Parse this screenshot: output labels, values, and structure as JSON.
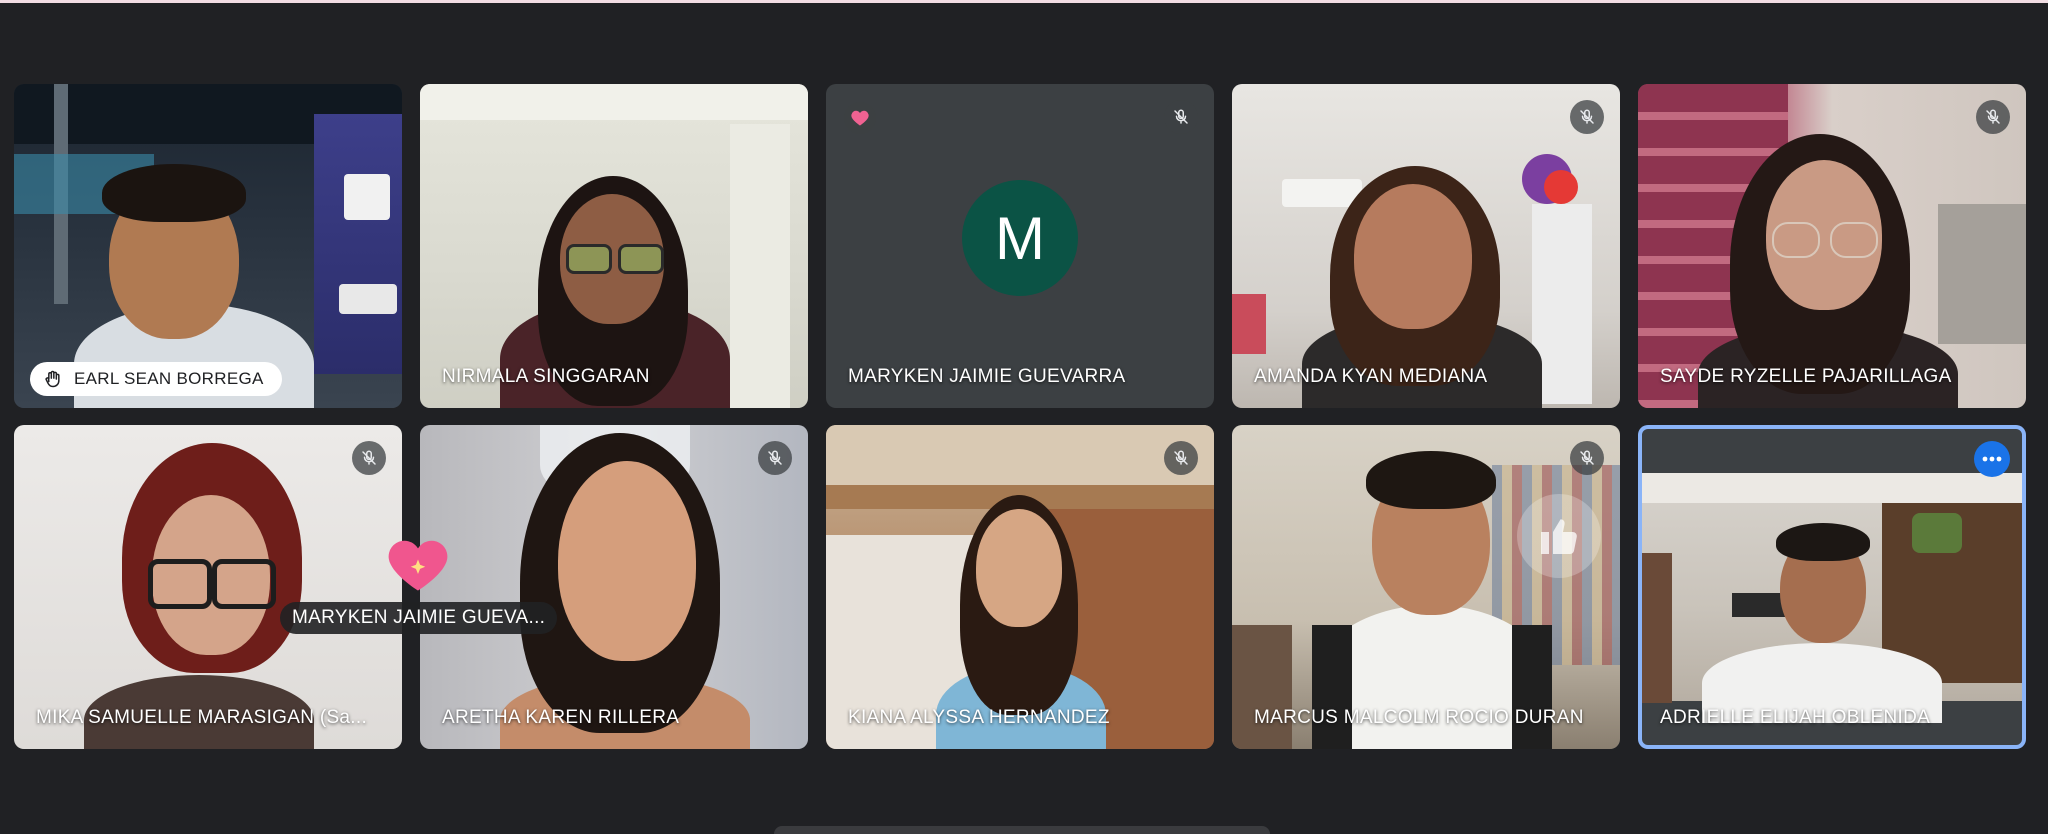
{
  "participants": [
    {
      "name": "EARL SEAN BORREGA",
      "hand_raised": true,
      "muted": false
    },
    {
      "name": "NIRMALA SINGGARAN",
      "muted": false
    },
    {
      "name": "MARYKEN JAIMIE GUEVARRA",
      "avatar_letter": "M",
      "avatar_color": "#0b5345",
      "muted": true,
      "reaction": "heart"
    },
    {
      "name": "AMANDA KYAN MEDIANA",
      "muted": true
    },
    {
      "name": "SAYDE RYZELLE PAJARILLAGA",
      "muted": true
    },
    {
      "name": "MIKA SAMUELLE MARASIGAN (Sa...",
      "muted": true
    },
    {
      "name": "ARETHA KAREN RILLERA",
      "muted": true
    },
    {
      "name": "KIANA ALYSSA HERNANDEZ",
      "muted": true
    },
    {
      "name": "MARCUS MALCOLM ROCIO DURAN",
      "muted": true
    },
    {
      "name": "ADRIELLE ELIJAH OBLENIDA",
      "active_speaker": true
    }
  ],
  "floating_reaction": {
    "emoji": "heart",
    "sender": "MARYKEN JAIMIE GUEVA..."
  },
  "icons": {
    "mute": "mic-off-icon",
    "hand": "raised-hand-icon",
    "more": "more-options-icon",
    "thumb": "thumbs-up-icon"
  },
  "colors": {
    "background": "#202124",
    "tile": "#3c4043",
    "active_border": "#8ab4f8",
    "more_button": "#1a73e8",
    "avatar": "#0b5345"
  }
}
